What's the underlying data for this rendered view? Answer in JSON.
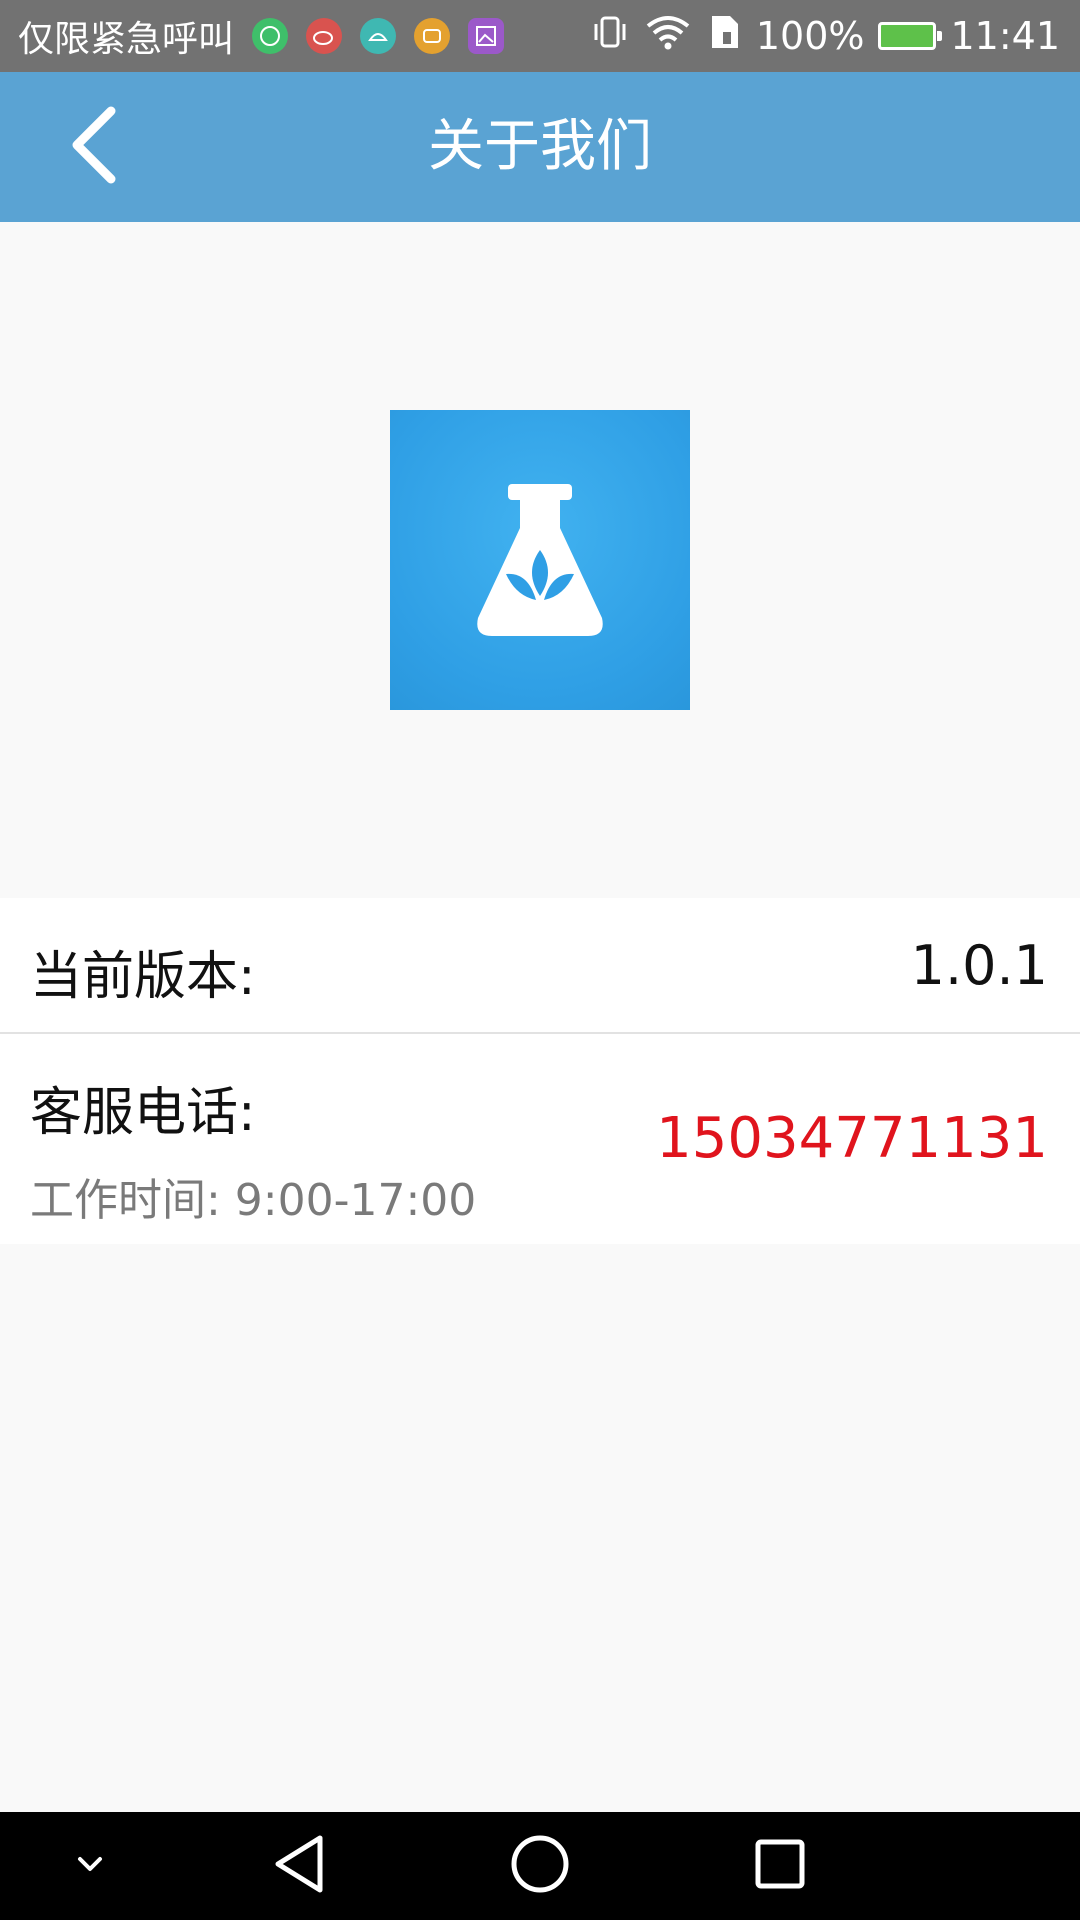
{
  "status_bar": {
    "carrier": "仅限紧急呼叫",
    "battery": "100%",
    "time": "11:41",
    "notification_icons": [
      "wechat-icon",
      "weibo-icon",
      "android-icon",
      "cat-app-icon",
      "gallery-icon"
    ],
    "colors": {
      "background": "#727272",
      "battery_fill": "#5ec14a"
    }
  },
  "header": {
    "title": "关于我们",
    "back_icon": "back-chevron-icon",
    "background": "#5aa3d3"
  },
  "logo": {
    "icon": "flask-leaf-icon",
    "background": "#2f9fe5"
  },
  "info": {
    "version_label": "当前版本:",
    "version_value": "1.0.1",
    "phone_label": "客服电话:",
    "work_hours": "工作时间:  9:00-17:00",
    "phone_number": "15034771131",
    "phone_color": "#e0141d"
  },
  "nav_bar": {
    "items": [
      "collapse-chevron-icon",
      "back-triangle-icon",
      "home-circle-icon",
      "recents-square-icon"
    ]
  }
}
